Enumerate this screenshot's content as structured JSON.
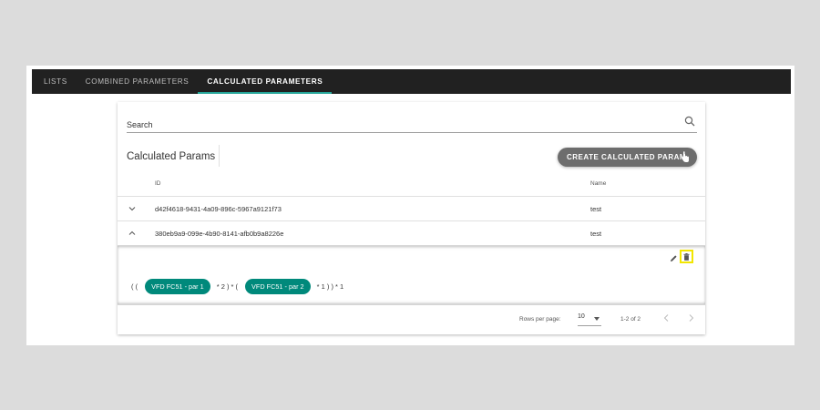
{
  "tabs": [
    {
      "label": "LISTS",
      "active": false
    },
    {
      "label": "COMBINED PARAMETERS",
      "active": false
    },
    {
      "label": "CALCULATED PARAMETERS",
      "active": true
    }
  ],
  "search": {
    "placeholder": "Search",
    "value": "",
    "icon": "search-icon"
  },
  "section": {
    "title": "Calculated Params",
    "create_button_label": "CREATE CALCULATED PARAM"
  },
  "table": {
    "columns": [
      "ID",
      "Name"
    ],
    "rows": [
      {
        "id": "d42f4618-9431-4a09-896c-5967a9121f73",
        "name": "test",
        "expanded": false
      },
      {
        "id": "380eb9a9-099e-4b90-8141-afb0b9a8226e",
        "name": "test",
        "expanded": true
      }
    ]
  },
  "expanded_formula": {
    "prefix": "( (",
    "chip1": "VFD FC51 - par 1",
    "middle": "* 2 ) * (",
    "chip2": "VFD FC51 - par 2",
    "suffix": "* 1 ) ) * 1"
  },
  "pagination": {
    "rows_per_page_label": "Rows per page:",
    "rows_per_page_value": "10",
    "range_text": "1-2 of 2"
  },
  "colors": {
    "tabbar": "#212121",
    "accent": "#26a69a",
    "chip": "#00897b",
    "button": "#6d6d6d",
    "highlight": "#f2e600"
  }
}
